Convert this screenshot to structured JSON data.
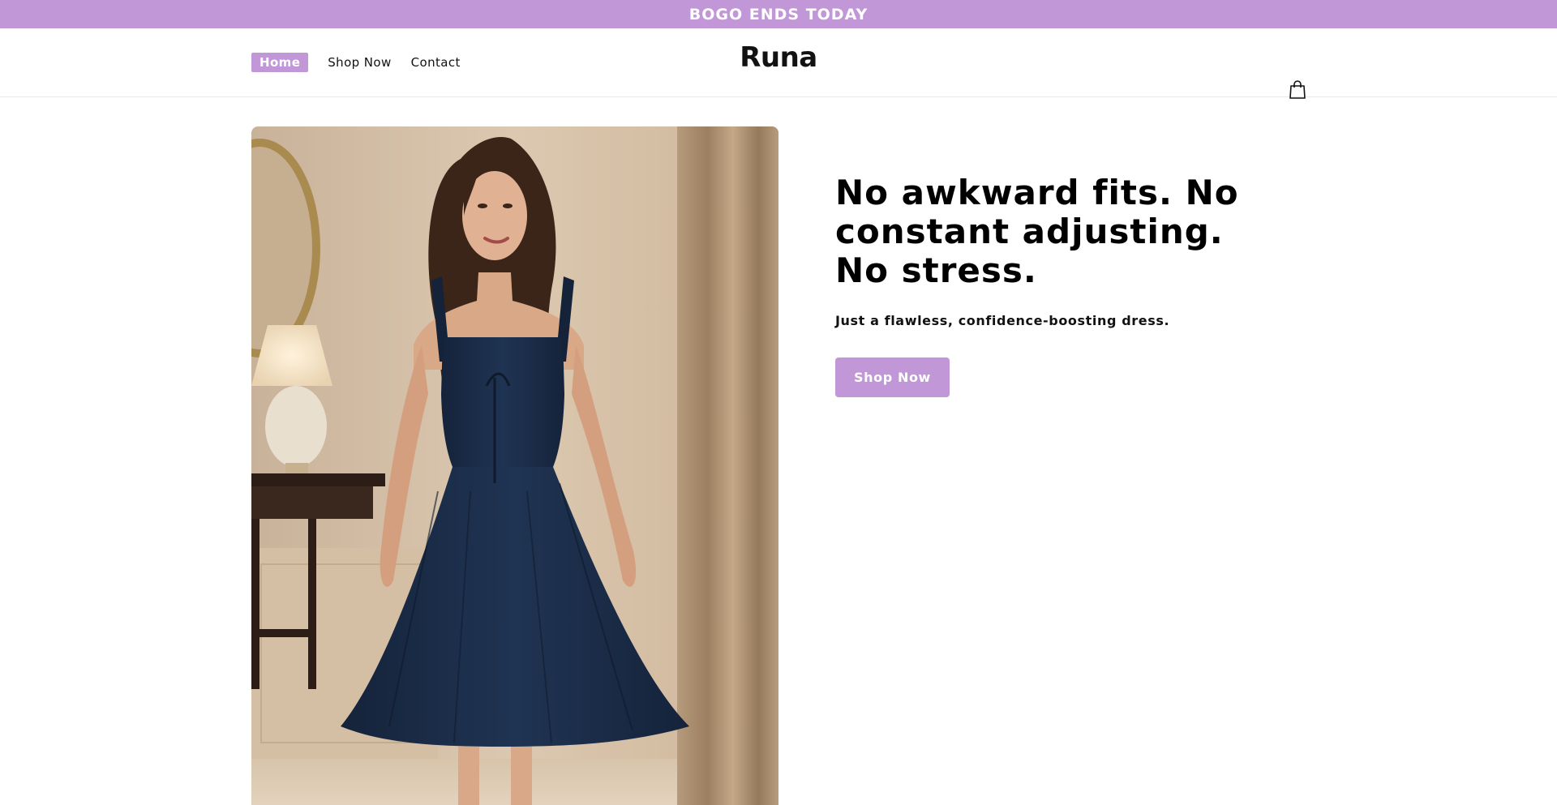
{
  "announcement": {
    "text": "BOGO ENDS TODAY"
  },
  "header": {
    "nav": [
      {
        "label": "Home",
        "active": true
      },
      {
        "label": "Shop Now",
        "active": false
      },
      {
        "label": "Contact",
        "active": false
      }
    ],
    "logo": "Runa",
    "cart_icon": "shopping-bag-icon"
  },
  "hero": {
    "heading": "No awkward fits. No constant adjusting. No stress.",
    "subheading": "Just a flawless, confidence-boosting dress.",
    "cta_label": "Shop Now",
    "image": {
      "subject": "model-in-navy-midi-dress"
    }
  },
  "colors": {
    "accent": "#c197d7",
    "text": "#121212",
    "dress": "#1a2b45"
  }
}
